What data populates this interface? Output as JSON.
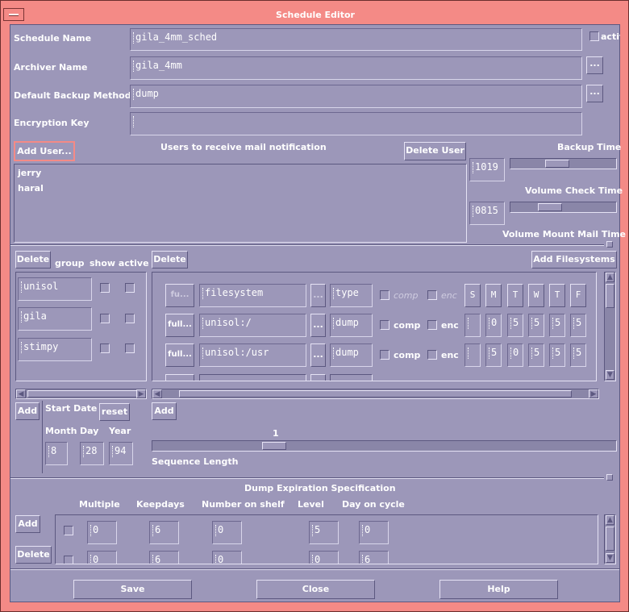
{
  "window": {
    "title": "Schedule Editor"
  },
  "form": {
    "schedule_name_label": "Schedule Name",
    "schedule_name_value": "gila_4mm_sched",
    "active_label": "activ",
    "archiver_name_label": "Archiver Name",
    "archiver_name_value": "gila_4mm",
    "backup_method_label": "Default Backup Method",
    "backup_method_value": "dump",
    "encryption_key_label": "Encryption Key",
    "encryption_key_value": "",
    "ellipsis": "..."
  },
  "users": {
    "add_label": "Add User...",
    "heading": "Users to receive mail notification",
    "delete_label": "Delete User",
    "list": [
      "jerry",
      "haral"
    ]
  },
  "times": {
    "backup_time_label": "Backup Time",
    "backup_time_value": "1019",
    "volume_check_label": "Volume Check Time",
    "volume_check_value": "0815",
    "volume_mount_label": "Volume Mount Mail Time"
  },
  "groups": {
    "delete_label": "Delete",
    "group_header": "group",
    "show_active_header": "show active",
    "rows": [
      "unisol",
      "gila",
      "stimpy"
    ],
    "add_label": "Add"
  },
  "filesystems": {
    "delete_label": "Delete",
    "add_label": "Add Filesystems",
    "header": {
      "full": "fu...",
      "filesystem": "filesystem",
      "ellipsis": "...",
      "type": "type",
      "comp": "comp",
      "enc": "enc",
      "days": [
        "S",
        "M",
        "T",
        "W",
        "T",
        "F"
      ]
    },
    "rows": [
      {
        "full": "full...",
        "filesystem": "unisol:/",
        "ellipsis": "...",
        "type": "dump",
        "comp": "comp",
        "enc": "enc",
        "days": [
          "",
          "0",
          "5",
          "5",
          "5",
          "5"
        ]
      },
      {
        "full": "full...",
        "filesystem": "unisol:/usr",
        "ellipsis": "...",
        "type": "dump",
        "comp": "comp",
        "enc": "enc",
        "days": [
          "",
          "5",
          "0",
          "5",
          "5",
          "5"
        ]
      }
    ],
    "add_bottom_label": "Add"
  },
  "start_date": {
    "label": "Start Date",
    "reset_label": "reset",
    "month_label": "Month",
    "day_label": "Day",
    "year_label": "Year",
    "month": "8",
    "day": "28",
    "year": "94"
  },
  "sequence": {
    "value": "1",
    "label": "Sequence Length"
  },
  "expiration": {
    "heading": "Dump Expiration Specification",
    "headers": [
      "Multiple",
      "Keepdays",
      "Number on shelf",
      "Level",
      "Day on cycle"
    ],
    "add_label": "Add",
    "delete_label": "Delete",
    "rows": [
      {
        "multiple": "0",
        "keepdays": "6",
        "number_on_shelf": "0",
        "level": "5",
        "day_on_cycle": "0"
      },
      {
        "multiple": "0",
        "keepdays": "6",
        "number_on_shelf": "0",
        "level": "0",
        "day_on_cycle": "6"
      }
    ]
  },
  "footer": {
    "save": "Save",
    "close": "Close",
    "help": "Help"
  }
}
